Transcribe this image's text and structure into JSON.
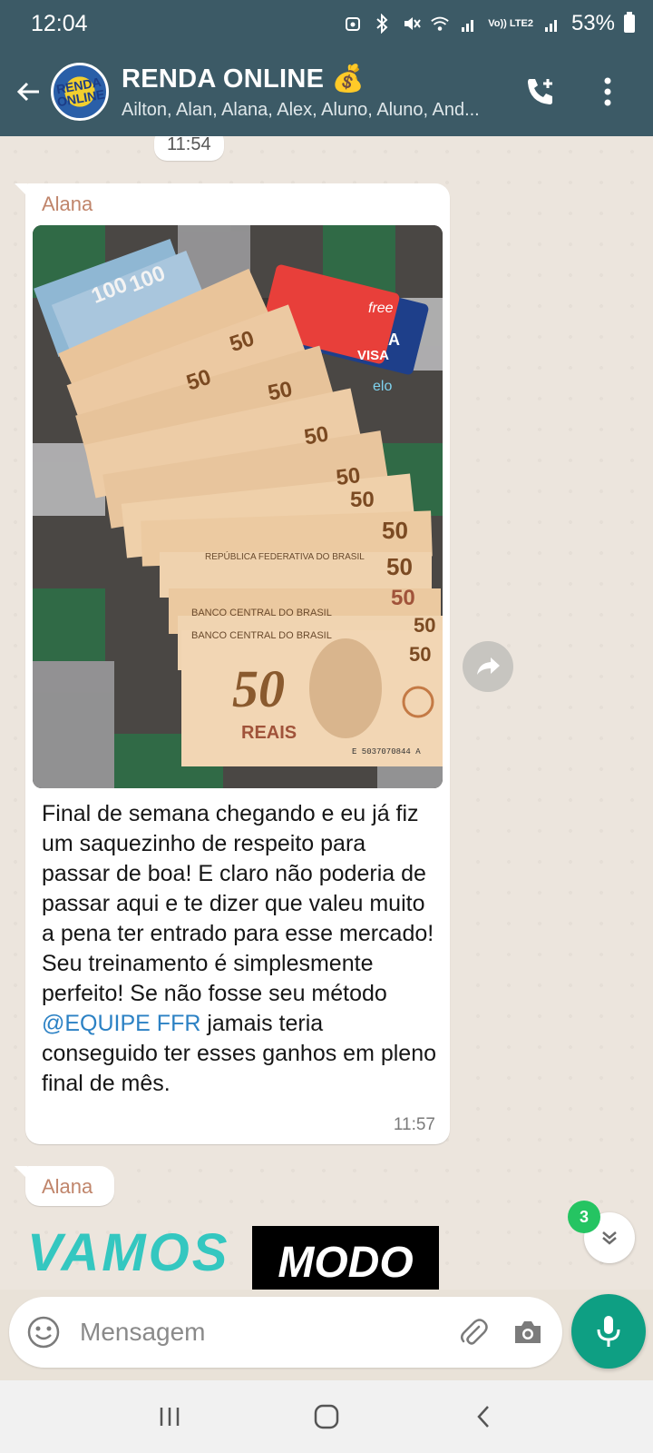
{
  "status_bar": {
    "time": "12:04",
    "lte_label": "Vo)) LTE2",
    "battery": "53%"
  },
  "header": {
    "title": "RENDA ONLINE 💰",
    "members": "Ailton, Alan, Alana, Alex, Aluno, Aluno, And...",
    "avatar_text": "RENDA ONLINE"
  },
  "chat": {
    "time_divider": "11:54",
    "messages": [
      {
        "sender": "Alana",
        "image_notes": {
          "bank_card_1": "free",
          "bank_card_1_brand": "VISA",
          "bank_card_2": "IXA",
          "bank_card_2_brand": "elo",
          "note_value": "50",
          "note_100": "100",
          "note_text_1": "REPÚBLICA FEDERATIVA DO BRASIL",
          "note_text_2": "BANCO CENTRAL DO BRASIL",
          "note_reais": "REAIS",
          "note_serial": "E 5037070844 A"
        },
        "text_before": "Final de semana chegando e eu já fiz um saquezinho de respeito para passar de boa! E claro não poderia de passar aqui e te dizer que valeu muito a pena ter entrado para esse mercado! Seu treinamento é simplesmente perfeito! Se não fosse seu método ",
        "mention": "@EQUIPE FFR",
        "text_after": " jamais teria conseguido ter esses ganhos em pleno final de mês.",
        "time": "11:57"
      },
      {
        "sender": "Alana",
        "promo_left": "VAMOS",
        "promo_right": "MODO"
      }
    ],
    "unread_count": "3"
  },
  "composer": {
    "placeholder": "Mensagem"
  },
  "colors": {
    "header_bg": "#3c5a66",
    "chat_bg": "#ece5dd",
    "mic_bg": "#0e9f83",
    "badge_bg": "#25c462",
    "mention": "#2b81c4",
    "sender": "#c0856b"
  },
  "icons": [
    "back-arrow-icon",
    "add-call-icon",
    "more-vert-icon",
    "forward-icon",
    "chevron-down-double-icon",
    "emoji-icon",
    "attach-icon",
    "camera-icon",
    "mic-icon",
    "nav-recents-icon",
    "nav-home-icon",
    "nav-back-icon"
  ]
}
